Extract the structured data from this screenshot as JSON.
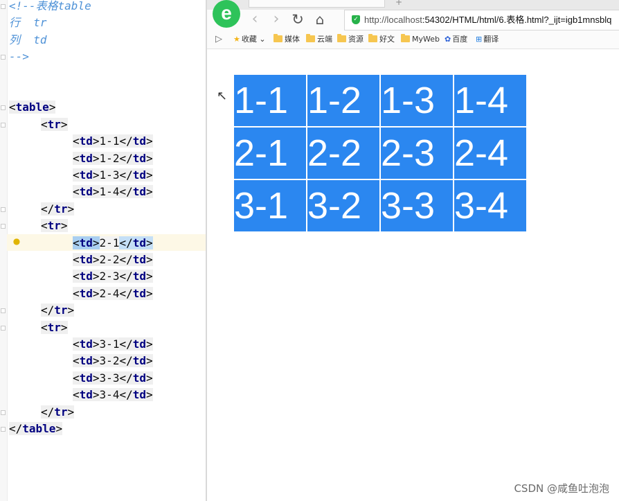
{
  "editor": {
    "lines": [
      {
        "parts": [
          {
            "t": "<!--表格table",
            "c": "cmt"
          }
        ]
      },
      {
        "parts": [
          {
            "t": "行  tr",
            "c": "cmt"
          }
        ]
      },
      {
        "parts": [
          {
            "t": "列  td",
            "c": "cmt"
          }
        ]
      },
      {
        "parts": [
          {
            "t": "-->",
            "c": "cmt"
          }
        ]
      },
      {
        "parts": []
      },
      {
        "parts": []
      },
      {
        "parts": [
          {
            "t": "<",
            "c": "tagbox"
          },
          {
            "t": "table",
            "c": "tagbox tn"
          },
          {
            "t": ">",
            "c": "tagbox"
          }
        ]
      },
      {
        "indent": 1,
        "parts": [
          {
            "t": "<",
            "c": "tagbox"
          },
          {
            "t": "tr",
            "c": "tagbox tn"
          },
          {
            "t": ">",
            "c": "tagbox"
          }
        ]
      },
      {
        "indent": 2,
        "parts": [
          {
            "t": "<",
            "c": "tagbox"
          },
          {
            "t": "td",
            "c": "tagbox tn"
          },
          {
            "t": ">",
            "c": "tagbox"
          },
          {
            "t": "1-1",
            "c": "txt"
          },
          {
            "t": "</",
            "c": "tagbox"
          },
          {
            "t": "td",
            "c": "tagbox tn"
          },
          {
            "t": ">",
            "c": "tagbox"
          }
        ]
      },
      {
        "indent": 2,
        "parts": [
          {
            "t": "<",
            "c": "tagbox"
          },
          {
            "t": "td",
            "c": "tagbox tn"
          },
          {
            "t": ">",
            "c": "tagbox"
          },
          {
            "t": "1-2",
            "c": "txt"
          },
          {
            "t": "</",
            "c": "tagbox"
          },
          {
            "t": "td",
            "c": "tagbox tn"
          },
          {
            "t": ">",
            "c": "tagbox"
          }
        ]
      },
      {
        "indent": 2,
        "parts": [
          {
            "t": "<",
            "c": "tagbox"
          },
          {
            "t": "td",
            "c": "tagbox tn"
          },
          {
            "t": ">",
            "c": "tagbox"
          },
          {
            "t": "1-3",
            "c": "txt"
          },
          {
            "t": "</",
            "c": "tagbox"
          },
          {
            "t": "td",
            "c": "tagbox tn"
          },
          {
            "t": ">",
            "c": "tagbox"
          }
        ]
      },
      {
        "indent": 2,
        "parts": [
          {
            "t": "<",
            "c": "tagbox"
          },
          {
            "t": "td",
            "c": "tagbox tn"
          },
          {
            "t": ">",
            "c": "tagbox"
          },
          {
            "t": "1-4",
            "c": "txt"
          },
          {
            "t": "</",
            "c": "tagbox"
          },
          {
            "t": "td",
            "c": "tagbox tn"
          },
          {
            "t": ">",
            "c": "tagbox"
          }
        ]
      },
      {
        "indent": 1,
        "parts": [
          {
            "t": "</",
            "c": "tagbox"
          },
          {
            "t": "tr",
            "c": "tagbox tn"
          },
          {
            "t": ">",
            "c": "tagbox"
          }
        ]
      },
      {
        "indent": 1,
        "parts": [
          {
            "t": "<",
            "c": "tagbox"
          },
          {
            "t": "tr",
            "c": "tagbox tn"
          },
          {
            "t": ">",
            "c": "tagbox"
          }
        ]
      },
      {
        "indent": 2,
        "parts": [
          {
            "t": "<",
            "c": "tagbox sel"
          },
          {
            "t": "td",
            "c": "tagbox sel tn"
          },
          {
            "t": ">",
            "c": "tagbox sel"
          },
          {
            "t": "2-1",
            "c": "txt"
          },
          {
            "t": "</",
            "c": "tagbox sel2"
          },
          {
            "t": "td",
            "c": "tagbox sel2 tn"
          },
          {
            "t": ">",
            "c": "tagbox sel2"
          }
        ]
      },
      {
        "indent": 2,
        "parts": [
          {
            "t": "<",
            "c": "tagbox"
          },
          {
            "t": "td",
            "c": "tagbox tn"
          },
          {
            "t": ">",
            "c": "tagbox"
          },
          {
            "t": "2-2",
            "c": "txt"
          },
          {
            "t": "</",
            "c": "tagbox"
          },
          {
            "t": "td",
            "c": "tagbox tn"
          },
          {
            "t": ">",
            "c": "tagbox"
          }
        ]
      },
      {
        "indent": 2,
        "parts": [
          {
            "t": "<",
            "c": "tagbox"
          },
          {
            "t": "td",
            "c": "tagbox tn"
          },
          {
            "t": ">",
            "c": "tagbox"
          },
          {
            "t": "2-3",
            "c": "txt"
          },
          {
            "t": "</",
            "c": "tagbox"
          },
          {
            "t": "td",
            "c": "tagbox tn"
          },
          {
            "t": ">",
            "c": "tagbox"
          }
        ]
      },
      {
        "indent": 2,
        "parts": [
          {
            "t": "<",
            "c": "tagbox"
          },
          {
            "t": "td",
            "c": "tagbox tn"
          },
          {
            "t": ">",
            "c": "tagbox"
          },
          {
            "t": "2-4",
            "c": "txt"
          },
          {
            "t": "</",
            "c": "tagbox"
          },
          {
            "t": "td",
            "c": "tagbox tn"
          },
          {
            "t": ">",
            "c": "tagbox"
          }
        ]
      },
      {
        "indent": 1,
        "parts": [
          {
            "t": "</",
            "c": "tagbox"
          },
          {
            "t": "tr",
            "c": "tagbox tn"
          },
          {
            "t": ">",
            "c": "tagbox"
          }
        ]
      },
      {
        "indent": 1,
        "parts": [
          {
            "t": "<",
            "c": "tagbox"
          },
          {
            "t": "tr",
            "c": "tagbox tn"
          },
          {
            "t": ">",
            "c": "tagbox"
          }
        ]
      },
      {
        "indent": 2,
        "parts": [
          {
            "t": "<",
            "c": "tagbox"
          },
          {
            "t": "td",
            "c": "tagbox tn"
          },
          {
            "t": ">",
            "c": "tagbox"
          },
          {
            "t": "3-1",
            "c": "txt"
          },
          {
            "t": "</",
            "c": "tagbox"
          },
          {
            "t": "td",
            "c": "tagbox tn"
          },
          {
            "t": ">",
            "c": "tagbox"
          }
        ]
      },
      {
        "indent": 2,
        "parts": [
          {
            "t": "<",
            "c": "tagbox"
          },
          {
            "t": "td",
            "c": "tagbox tn"
          },
          {
            "t": ">",
            "c": "tagbox"
          },
          {
            "t": "3-2",
            "c": "txt"
          },
          {
            "t": "</",
            "c": "tagbox"
          },
          {
            "t": "td",
            "c": "tagbox tn"
          },
          {
            "t": ">",
            "c": "tagbox"
          }
        ]
      },
      {
        "indent": 2,
        "parts": [
          {
            "t": "<",
            "c": "tagbox"
          },
          {
            "t": "td",
            "c": "tagbox tn"
          },
          {
            "t": ">",
            "c": "tagbox"
          },
          {
            "t": "3-3",
            "c": "txt"
          },
          {
            "t": "</",
            "c": "tagbox"
          },
          {
            "t": "td",
            "c": "tagbox tn"
          },
          {
            "t": ">",
            "c": "tagbox"
          }
        ]
      },
      {
        "indent": 2,
        "parts": [
          {
            "t": "<",
            "c": "tagbox"
          },
          {
            "t": "td",
            "c": "tagbox tn"
          },
          {
            "t": ">",
            "c": "tagbox"
          },
          {
            "t": "3-4",
            "c": "txt"
          },
          {
            "t": "</",
            "c": "tagbox"
          },
          {
            "t": "td",
            "c": "tagbox tn"
          },
          {
            "t": ">",
            "c": "tagbox"
          }
        ]
      },
      {
        "indent": 1,
        "parts": [
          {
            "t": "</",
            "c": "tagbox"
          },
          {
            "t": "tr",
            "c": "tagbox tn"
          },
          {
            "t": ">",
            "c": "tagbox"
          }
        ]
      },
      {
        "parts": [
          {
            "t": "</",
            "c": "tagbox"
          },
          {
            "t": "table",
            "c": "tagbox tn"
          },
          {
            "t": ">",
            "c": "tagbox"
          }
        ]
      }
    ]
  },
  "browser": {
    "logo_letter": "e",
    "url_host": "http://localhost",
    "url_rest": ":54302/HTML/html/6.表格.html?_ijt=igb1mnsblq",
    "bookmarks": [
      {
        "label": "收藏",
        "icon": "star-icon"
      },
      {
        "label": "媒体",
        "icon": "folder-icon"
      },
      {
        "label": "云端",
        "icon": "folder-icon"
      },
      {
        "label": "资源",
        "icon": "folder-icon"
      },
      {
        "label": "好文",
        "icon": "folder-icon"
      },
      {
        "label": "MyWeb",
        "icon": "folder-icon"
      },
      {
        "label": "百度",
        "icon": "baidu-icon"
      },
      {
        "label": "翻译",
        "icon": "translate-icon"
      }
    ],
    "accent": "#2b87f0"
  },
  "table": {
    "rows": [
      [
        "1-1",
        "1-2",
        "1-3",
        "1-4"
      ],
      [
        "2-1",
        "2-2",
        "2-3",
        "2-4"
      ],
      [
        "3-1",
        "3-2",
        "3-3",
        "3-4"
      ]
    ]
  },
  "watermark": "CSDN @咸鱼吐泡泡"
}
